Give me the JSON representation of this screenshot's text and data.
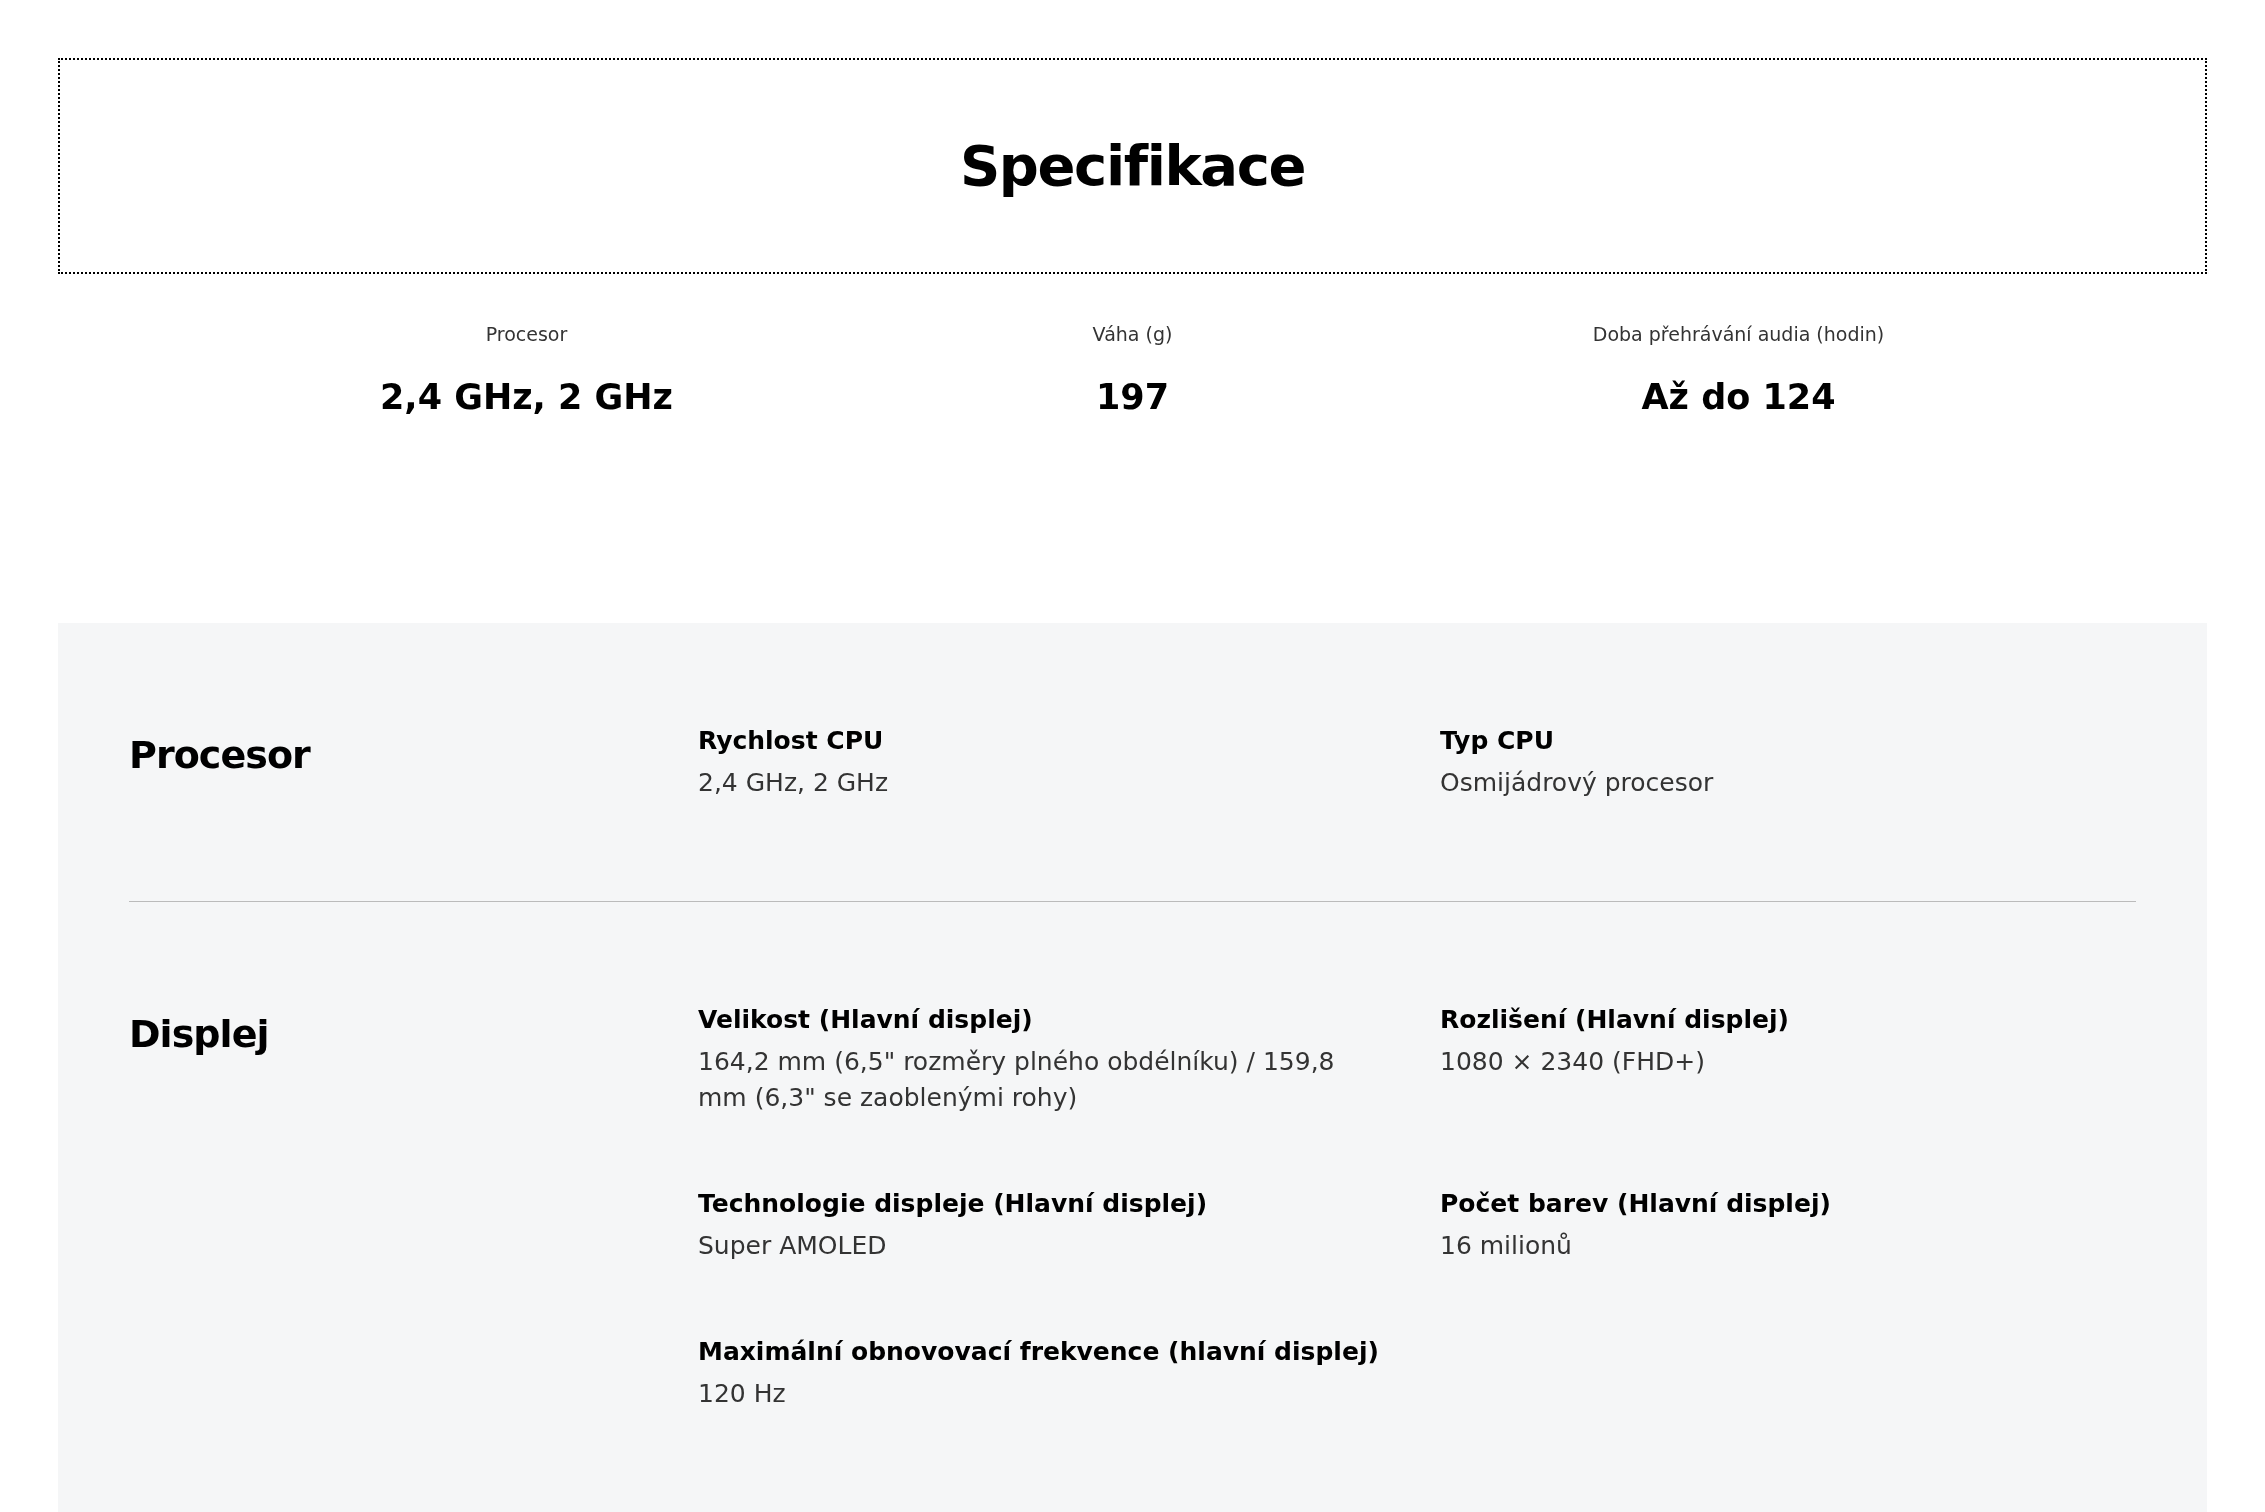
{
  "title": "Specifikace",
  "highlights": [
    {
      "label": "Procesor",
      "value": "2,4 GHz, 2 GHz"
    },
    {
      "label": "Váha (g)",
      "value": "197"
    },
    {
      "label": "Doba přehrávání audia (hodin)",
      "value": "Až do 124"
    }
  ],
  "sections": [
    {
      "title": "Procesor",
      "specs": [
        {
          "label": "Rychlost CPU",
          "value": "2,4 GHz, 2 GHz"
        },
        {
          "label": "Typ CPU",
          "value": "Osmijádrový procesor"
        }
      ]
    },
    {
      "title": "Displej",
      "specs": [
        {
          "label": "Velikost (Hlavní displej)",
          "value": "164,2 mm (6,5\" rozměry plného obdélníku) / 159,8 mm (6,3\" se zaoblenými rohy)"
        },
        {
          "label": "Rozlišení (Hlavní displej)",
          "value": "1080 × 2340 (FHD+)"
        },
        {
          "label": "Technologie displeje (Hlavní displej)",
          "value": "Super AMOLED"
        },
        {
          "label": "Počet barev (Hlavní displej)",
          "value": "16 milionů"
        },
        {
          "label": "Maximální obnovovací frekvence (hlavní displej)",
          "value": "120 Hz"
        }
      ]
    }
  ]
}
